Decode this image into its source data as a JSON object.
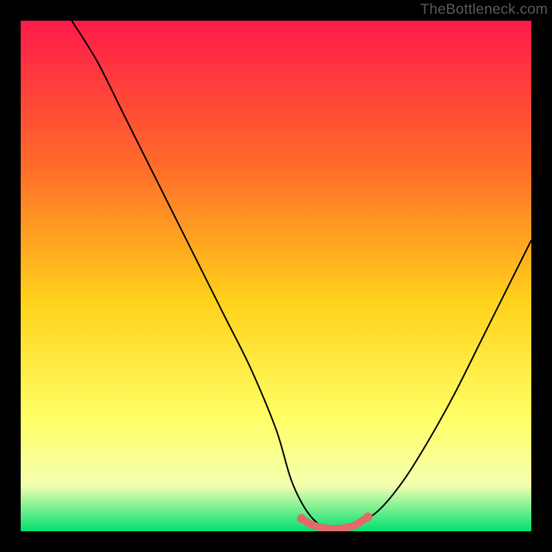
{
  "watermark": "TheBottleneck.com",
  "palette": {
    "bg": "#000000",
    "grad_top": "#ff1a4a",
    "grad_mid1": "#ff6a2a",
    "grad_mid2": "#ffd21a",
    "grad_mid3": "#ffff66",
    "grad_mid4": "#f4ffb0",
    "grad_bot": "#00e070",
    "curve": "#000000",
    "marker_fill": "#e26a6a",
    "marker_stroke": "#c94f4f"
  },
  "chart_data": {
    "type": "line",
    "title": "",
    "xlabel": "",
    "ylabel": "",
    "xlim": [
      0,
      100
    ],
    "ylim": [
      0,
      100
    ],
    "series": [
      {
        "name": "bottleneck-curve",
        "x": [
          10,
          15,
          20,
          25,
          30,
          35,
          40,
          45,
          50,
          53,
          56,
          59,
          62,
          65,
          70,
          75,
          80,
          85,
          90,
          95,
          100
        ],
        "y": [
          100,
          92,
          82,
          72,
          62,
          52,
          42,
          32,
          20,
          10,
          4,
          1,
          0.5,
          1,
          4,
          10,
          18,
          27,
          37,
          47,
          57
        ]
      }
    ],
    "markers": {
      "name": "bottom-markers",
      "x": [
        55,
        57,
        59,
        60,
        61,
        62,
        63,
        64,
        65,
        66,
        68
      ],
      "y": [
        2.5,
        1.3,
        0.7,
        0.6,
        0.5,
        0.5,
        0.6,
        0.8,
        1.0,
        1.5,
        2.8
      ]
    }
  }
}
